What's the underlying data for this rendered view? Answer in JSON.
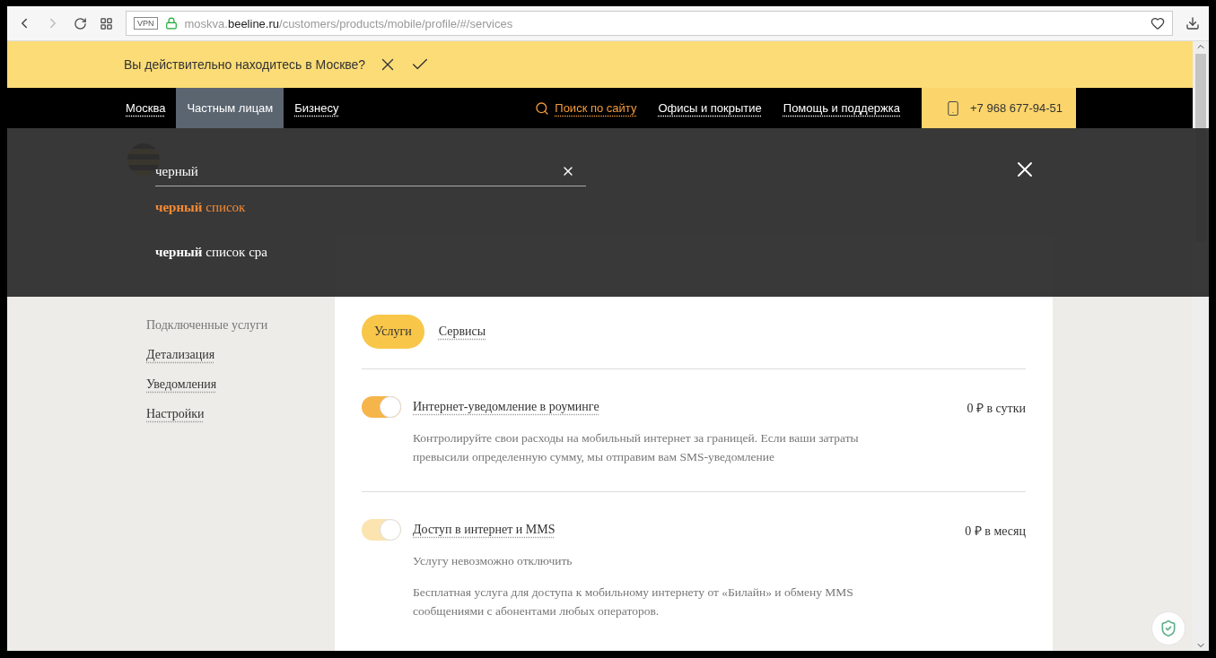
{
  "browser": {
    "vpn": "VPN",
    "url_host_prefix": "moskva.",
    "url_host": "beeline.ru",
    "url_path": "/customers/products/mobile/profile/#/services"
  },
  "location_bar": {
    "question": "Вы действительно находитесь в Москве?"
  },
  "top_nav": {
    "city": "Москва",
    "segments": [
      {
        "label": "Частным лицам",
        "selected": true
      },
      {
        "label": "Бизнесу",
        "selected": false
      }
    ],
    "search_link": "Поиск по сайту",
    "links": [
      "Офисы и покрытие",
      "Помощь и поддержка"
    ],
    "phone": "+7 968 677-94-51"
  },
  "sidebar": {
    "items": [
      {
        "label": "Подключенные услуги",
        "selected": true
      },
      {
        "label": "Детализация",
        "selected": false
      },
      {
        "label": "Уведомления",
        "selected": false
      },
      {
        "label": "Настройки",
        "selected": false
      }
    ]
  },
  "card": {
    "tabs": [
      {
        "label": "Услуги",
        "selected": true
      },
      {
        "label": "Сервисы",
        "selected": false
      }
    ],
    "services": [
      {
        "name": "Интернет-уведомление в роуминге",
        "price": "0 ₽ в сутки",
        "on": true,
        "disabled": false,
        "notes": [
          "Контролируйте свои расходы на мобильный интернет за границей. Если ваши затраты превысили определенную сумму, мы отправим вам SMS-уведомление"
        ]
      },
      {
        "name": "Доступ в интернет и MMS",
        "price": "0 ₽ в месяц",
        "on": true,
        "disabled": true,
        "notes": [
          "Услугу невозможно отключить",
          "Бесплатная услуга для доступа к мобильному интернету от «Билайн» и обмену MMS сообщениями с абонентами любых операторов."
        ]
      }
    ]
  },
  "search_overlay": {
    "value": "черный",
    "suggestions": [
      {
        "text": "**черный** список",
        "selected": true
      },
      {
        "text": "**черный** список сра",
        "selected": false
      }
    ]
  }
}
